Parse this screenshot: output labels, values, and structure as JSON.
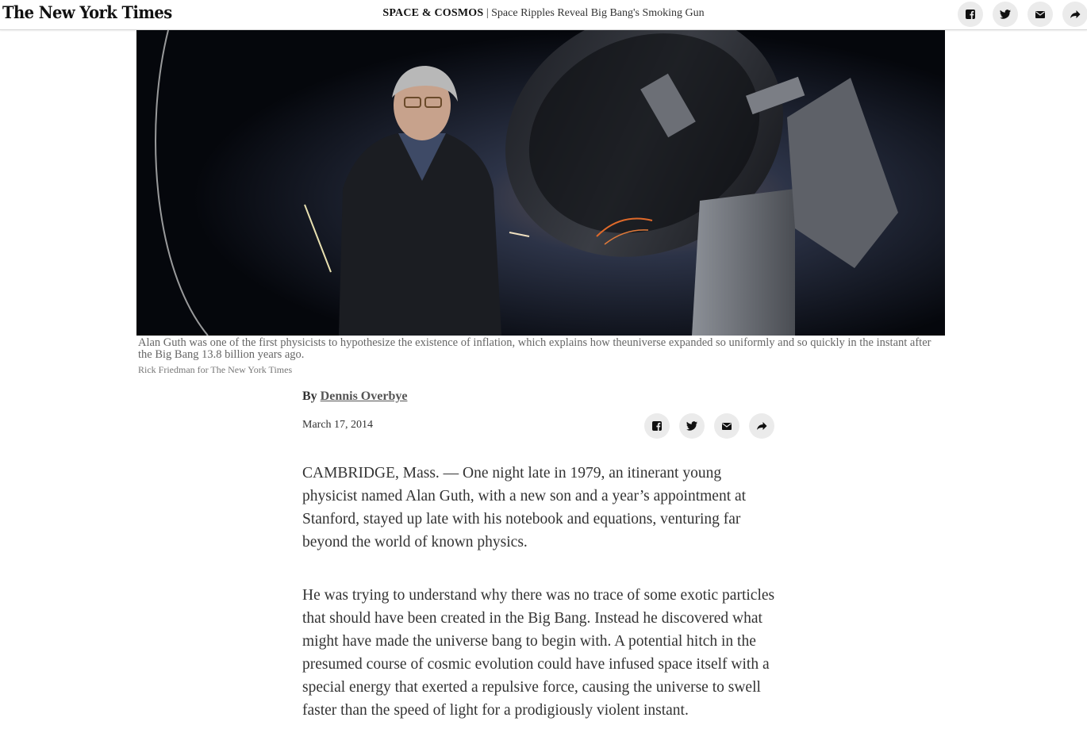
{
  "header": {
    "logo": "The New York Times",
    "section": "SPACE & COSMOS",
    "separator": " | ",
    "headline": "Space Ripples Reveal Big Bang's Smoking Gun"
  },
  "share": {
    "facebook": "facebook-icon",
    "twitter": "twitter-icon",
    "email": "email-icon",
    "more": "share-icon"
  },
  "hero": {
    "caption": "Alan Guth was one of the first physicists to hypothesize the existence of inflation, which explains how theuniverse expanded so uniformly and so quickly in the instant after the Big Bang 13.8 billion years ago.",
    "credit": "Rick Friedman for The New York Times"
  },
  "byline": {
    "by": "By",
    "author": "Dennis Overbye",
    "date": "March 17, 2014"
  },
  "body": {
    "paragraphs": [
      "CAMBRIDGE, Mass. — One night late in 1979, an itinerant young physicist named Alan Guth, with a new son and a year’s appointment at Stanford, stayed up late with his notebook and equations, venturing far beyond the world of known physics.",
      "He was trying to understand why there was no trace of some exotic particles that should have been created in the Big Bang. Instead he discovered what might have made the universe bang to begin with. A potential hitch in the presumed course of cosmic evolution could have infused space itself with a special energy that exerted a repulsive force, causing the universe to swell faster than the speed of light for a prodigiously violent instant."
    ]
  },
  "colors": {
    "share_bg": "#ebebeb",
    "text": "#333333",
    "caption": "#666666"
  }
}
